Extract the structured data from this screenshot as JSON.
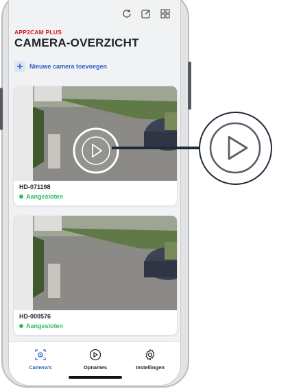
{
  "toolbar": {
    "icons": [
      "refresh-icon",
      "edit-icon",
      "grid-icon"
    ]
  },
  "header": {
    "brand": "APP2CAM PLUS",
    "title": "CAMERA-OVERZICHT"
  },
  "add_camera": {
    "label": "Nieuwe camera toevoegen"
  },
  "cameras": [
    {
      "name": "HD-071198",
      "status": "Aangesloten"
    },
    {
      "name": "HD-000576",
      "status": "Aangesloten"
    }
  ],
  "tabs": [
    {
      "label": "Camera's",
      "icon": "camera-icon",
      "active": true
    },
    {
      "label": "Opnames",
      "icon": "play-icon",
      "active": false
    },
    {
      "label": "Instellingen",
      "icon": "gear-icon",
      "active": false
    }
  ],
  "colors": {
    "brand": "#d11a2a",
    "accent": "#2c5fc7",
    "status": "#2ebd5f",
    "callout": "#1e2b3a"
  }
}
